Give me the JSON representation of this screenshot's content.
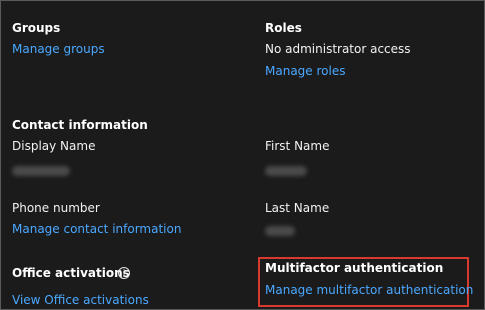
{
  "groups": {
    "heading": "Groups",
    "manage_link": "Manage groups"
  },
  "roles": {
    "heading": "Roles",
    "status": "No administrator access",
    "manage_link": "Manage roles"
  },
  "contact": {
    "heading": "Contact information",
    "display_name_label": "Display Name",
    "first_name_label": "First Name",
    "phone_label": "Phone number",
    "manage_link": "Manage contact information",
    "last_name_label": "Last Name"
  },
  "office": {
    "heading": "Office activations",
    "info_icon": "info-icon",
    "view_link": "View Office activations"
  },
  "mfa": {
    "heading": "Multifactor authentication",
    "manage_link": "Manage multifactor authentication",
    "highlight_color": "#d83a2e"
  },
  "colors": {
    "background": "#1b1b1b",
    "link": "#4aa8ff",
    "text": "#ffffff"
  }
}
